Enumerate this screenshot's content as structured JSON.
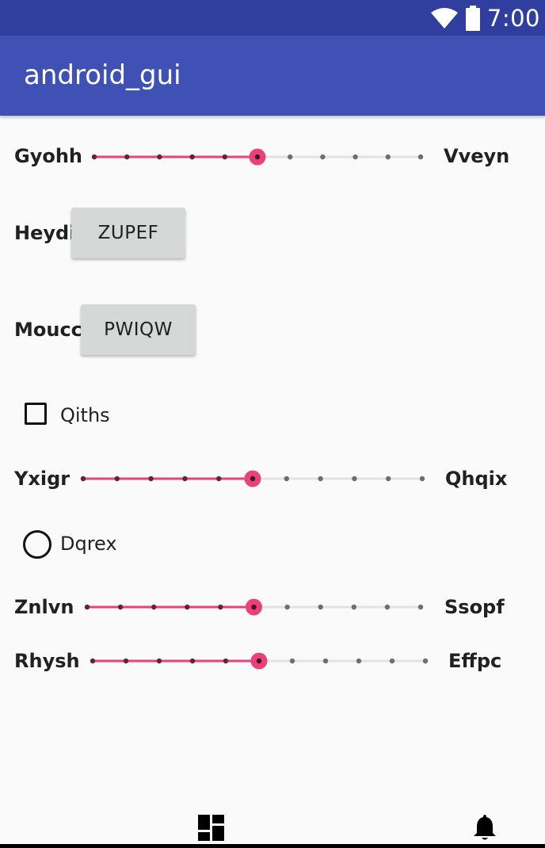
{
  "status_bar": {
    "time": "7:00",
    "icons": [
      "wifi-icon",
      "battery-icon"
    ]
  },
  "app_bar": {
    "title": "android_gui"
  },
  "colors": {
    "primary": "#3f51b5",
    "primary_dark": "#303f9f",
    "accent": "#ec407a"
  },
  "form": {
    "slider1": {
      "left_label": "Gyohh",
      "right_label": "Vveyn",
      "value": 5,
      "max": 10
    },
    "button1": {
      "label": "Heydi",
      "button_text": "ZUPEF"
    },
    "button2": {
      "label": "Moucc",
      "button_text": "PWIQW"
    },
    "checkbox": {
      "label": "Qiths",
      "checked": false
    },
    "slider2": {
      "left_label": "Yxigr",
      "right_label": "Qhqix",
      "value": 5,
      "max": 10
    },
    "radio": {
      "label": "Dqrex",
      "selected": false
    },
    "slider3": {
      "left_label": "Znlvn",
      "right_label": "Ssopf",
      "value": 5,
      "max": 10
    },
    "slider4": {
      "left_label": "Rhysh",
      "right_label": "Effpc",
      "value": 5,
      "max": 10
    }
  },
  "bottom_nav": {
    "icons": [
      "dashboard-icon",
      "notification-bell-icon"
    ]
  }
}
